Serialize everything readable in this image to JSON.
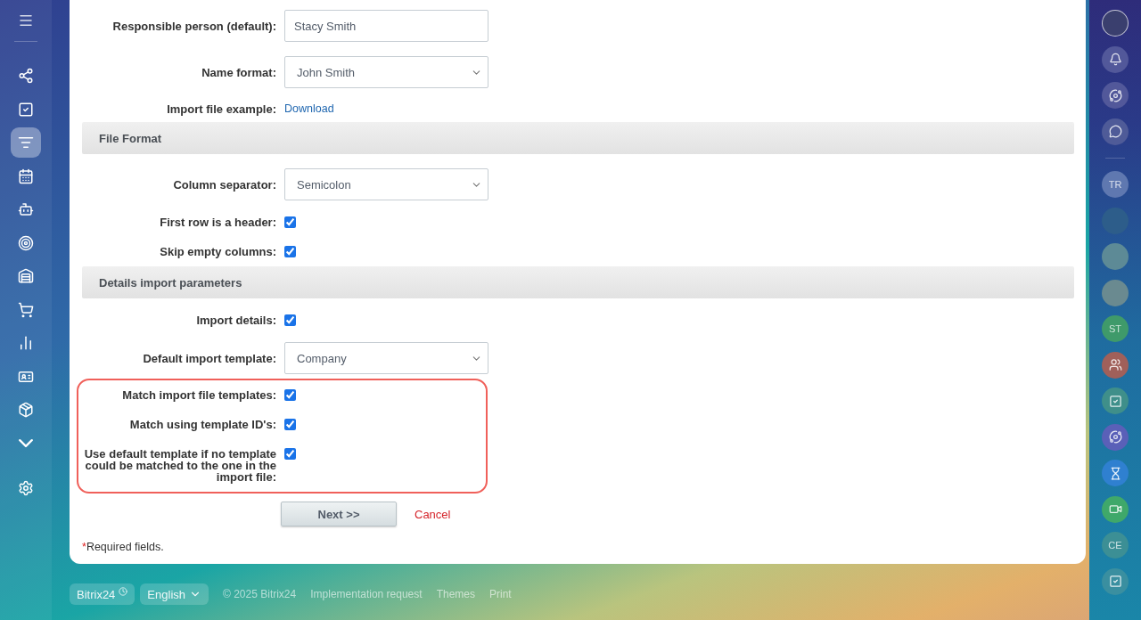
{
  "left_sidebar": {
    "items": [
      {
        "selected": false
      },
      {
        "selected": false
      },
      {
        "selected": true
      },
      {
        "selected": false
      },
      {
        "selected": false
      },
      {
        "selected": false
      },
      {
        "selected": false
      },
      {
        "selected": false
      },
      {
        "selected": false
      },
      {
        "selected": false
      },
      {
        "selected": false
      }
    ]
  },
  "form": [
    {
      "kind": "input",
      "label": "Responsible person (default):",
      "value": "Stacy Smith"
    },
    {
      "kind": "select",
      "label": "Name format:",
      "value": "John Smith"
    },
    {
      "kind": "link",
      "label": "Import file example:",
      "link": "Download"
    },
    {
      "kind": "section",
      "title": "File Format"
    },
    {
      "kind": "select",
      "label": "Column separator:",
      "value": "Semicolon"
    },
    {
      "kind": "checkbox",
      "label": "First row is a header:",
      "checked": true
    },
    {
      "kind": "checkbox",
      "label": "Skip empty columns:",
      "checked": true
    },
    {
      "kind": "section",
      "title": "Details import parameters"
    },
    {
      "kind": "checkbox",
      "label": "Import details:",
      "checked": true
    },
    {
      "kind": "select",
      "label": "Default import template:",
      "value": "Company"
    },
    {
      "kind": "group",
      "outlined": true,
      "children": [
        {
          "kind": "checkbox",
          "label": "Match import file templates:",
          "checked": true
        },
        {
          "kind": "checkbox",
          "label": "Match using template ID's:",
          "checked": true
        },
        {
          "kind": "checkbox",
          "label": "Use default template if no template could be matched to the one in the import file:",
          "checked": true
        }
      ]
    }
  ],
  "actions": {
    "next": "Next >>",
    "cancel": "Cancel"
  },
  "required_note": {
    "mark": "*",
    "text": "Required fields."
  },
  "footer": {
    "brand": "Bitrix24",
    "language": "English",
    "links": [
      "© 2025 Bitrix24",
      "Implementation request",
      "Themes",
      "Print"
    ]
  },
  "right_sidebar": {
    "items": [
      {
        "kind": "photo",
        "color": "#3a3f6e"
      },
      {
        "kind": "icon",
        "color": "#52589a"
      },
      {
        "kind": "icon",
        "color": "#52589a"
      },
      {
        "kind": "icon",
        "color": "#4f5b98"
      },
      {
        "kind": "divider"
      },
      {
        "kind": "initials",
        "text": "TR",
        "color": "#5f78b0"
      },
      {
        "kind": "photo",
        "color": "#2d5d8a"
      },
      {
        "kind": "photo",
        "color": "#5d8a96"
      },
      {
        "kind": "photo",
        "color": "#6a8a90"
      },
      {
        "kind": "initials",
        "text": "ST",
        "color": "#3f9a6a"
      },
      {
        "kind": "icon",
        "color": "#a0605a"
      },
      {
        "kind": "icon",
        "color": "#3f8f8a"
      },
      {
        "kind": "icon",
        "color": "#5a60b8"
      },
      {
        "kind": "icon",
        "color": "#2f80d0"
      },
      {
        "kind": "icon",
        "color": "#3fa86a"
      },
      {
        "kind": "initials",
        "text": "CE",
        "color": "#3c8f95"
      },
      {
        "kind": "icon",
        "color": "#3a8fa0"
      }
    ]
  }
}
